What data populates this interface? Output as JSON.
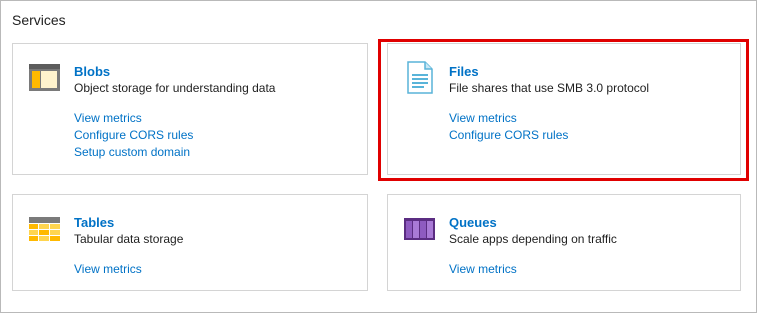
{
  "services": {
    "heading": "Services",
    "cards": [
      {
        "title": "Blobs",
        "description": "Object storage for understanding data",
        "icon": "blob-storage-icon",
        "links": [
          "View metrics",
          "Configure CORS rules",
          "Setup custom domain"
        ]
      },
      {
        "title": "Files",
        "description": "File shares that use SMB 3.0 protocol",
        "icon": "file-share-icon",
        "links": [
          "View metrics",
          "Configure CORS rules"
        ],
        "highlighted": true
      },
      {
        "title": "Tables",
        "description": "Tabular data storage",
        "icon": "table-storage-icon",
        "links": [
          "View metrics"
        ]
      },
      {
        "title": "Queues",
        "description": "Scale apps depending on traffic",
        "icon": "queue-storage-icon",
        "links": [
          "View metrics"
        ]
      }
    ]
  },
  "colors": {
    "link": "#0072c6",
    "highlight": "#e00000",
    "card_border": "#d4d4d4"
  }
}
